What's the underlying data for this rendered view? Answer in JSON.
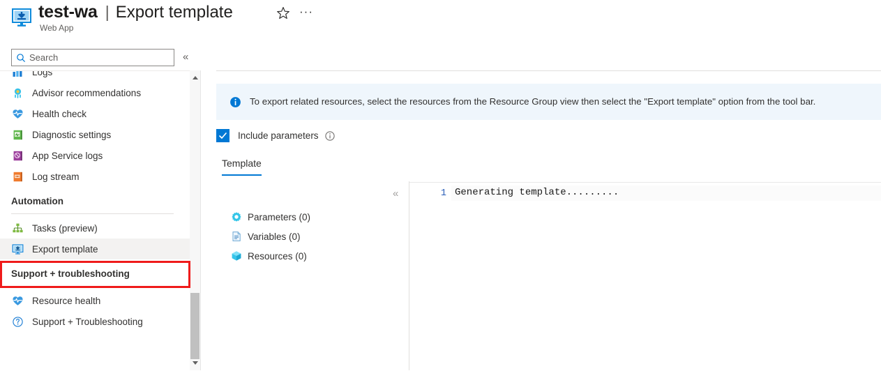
{
  "header": {
    "resource_name": "test-wa",
    "separator": "|",
    "page_title": "Export template",
    "resource_type": "Web App",
    "logo_icon": "export-template-monitor-icon",
    "favorite_icon": "star-outline-icon",
    "more_label": "···"
  },
  "search": {
    "placeholder": "Search",
    "value": "",
    "icon": "search-icon",
    "collapse_label": "«"
  },
  "sidebar": {
    "clipped_top_item": {
      "label": "Logs",
      "icon": "logs-icon"
    },
    "items": [
      {
        "label": "Advisor recommendations",
        "icon": "advisor-icon",
        "type": "item"
      },
      {
        "label": "Health check",
        "icon": "health-heart-icon",
        "type": "item"
      },
      {
        "label": "Diagnostic settings",
        "icon": "diagnostic-book-icon",
        "type": "item"
      },
      {
        "label": "App Service logs",
        "icon": "app-service-logs-icon",
        "type": "item"
      },
      {
        "label": "Log stream",
        "icon": "log-stream-icon",
        "type": "item"
      }
    ],
    "sections": [
      {
        "title": "Automation",
        "items": [
          {
            "label": "Tasks (preview)",
            "icon": "tasks-hierarchy-icon",
            "selected": false
          },
          {
            "label": "Export template",
            "icon": "export-template-monitor-icon",
            "selected": true
          }
        ]
      },
      {
        "title": "Support + troubleshooting",
        "items": [
          {
            "label": "Resource health",
            "icon": "health-heart-icon",
            "selected": false
          },
          {
            "label": "Support + Troubleshooting",
            "icon": "question-circle-icon",
            "selected": false
          }
        ]
      }
    ],
    "scrollbar": {
      "up_arrow": "scroll-up-arrow-icon",
      "down_arrow": "scroll-down-arrow-icon"
    },
    "highlight_color": "#ef1b1b"
  },
  "main": {
    "info_banner": {
      "icon": "info-circle-icon",
      "text": "To export related resources, select the resources from the Resource Group view then select the \"Export template\" option from the tool bar.",
      "background": "#eff6fc"
    },
    "include_parameters": {
      "label": "Include parameters",
      "checked": true,
      "checkbox_color": "#0078d4",
      "info_icon": "info-outline-icon"
    },
    "tabs": [
      {
        "label": "Template",
        "active": true
      }
    ],
    "tree": [
      {
        "label": "Parameters (0)",
        "icon": "parameters-gear-icon"
      },
      {
        "label": "Variables (0)",
        "icon": "variables-document-icon"
      },
      {
        "label": "Resources (0)",
        "icon": "resources-cube-icon"
      }
    ],
    "editor": {
      "collapse_label": "«",
      "line_number": "1",
      "content": "Generating template........."
    }
  },
  "colors": {
    "accent": "#0078d4",
    "info_bg": "#eff6fc",
    "selected_bg": "#f3f2f1",
    "highlight": "#ef1b1b"
  }
}
